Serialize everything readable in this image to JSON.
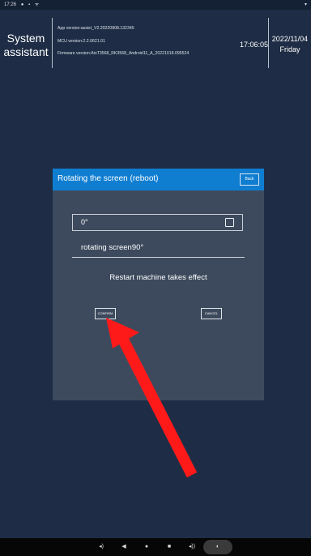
{
  "status_bar": {
    "time": "17:26",
    "icons": [
      "notification-icon",
      "photo-icon",
      "wifi-icon"
    ],
    "right_icons": [
      "battery-icon"
    ]
  },
  "header": {
    "app_name": "System assistant",
    "app_version": "App version:assist_V2.20220808.132345",
    "mcu_version": "MCU version:2.2.0621.01",
    "firmware_version": "Firmware version:AioT3568_RK3568_Android11_A_20221018.095524",
    "clock": "17:06:05",
    "date": "2022/11/04",
    "weekday": "Friday"
  },
  "dialog": {
    "title": "Rotating the screen (reboot)",
    "back_label": "Back",
    "rotation_value": "0°",
    "rotating_label": "rotating screen90°",
    "restart_note": "Restart machine takes effect",
    "confirm_label": "CONFIRM",
    "cancel_label": "CANCEL"
  },
  "annotation": {
    "arrow_color": "#ff1a1a",
    "target": "confirm-button"
  },
  "nav_bar": {
    "items": [
      {
        "name": "volume-down-icon",
        "glyph": "🔈"
      },
      {
        "name": "back-icon",
        "glyph": "◀"
      },
      {
        "name": "home-icon",
        "glyph": "●"
      },
      {
        "name": "recents-icon",
        "glyph": "■"
      },
      {
        "name": "volume-up-icon",
        "glyph": "🔊"
      },
      {
        "name": "toggle-icon",
        "glyph": "◐"
      }
    ]
  },
  "colors": {
    "background": "#1e2d45",
    "dialog": "#3d4a5d",
    "title_bar": "#0f7ed1"
  }
}
